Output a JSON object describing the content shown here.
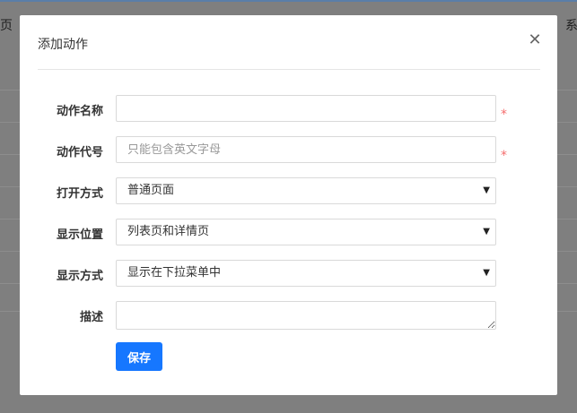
{
  "background": {
    "left_text": "页",
    "right_text": "系"
  },
  "modal": {
    "title": "添加动作",
    "close_icon": "close-icon"
  },
  "form": {
    "name": {
      "label": "动作名称",
      "value": "",
      "required_mark": "*"
    },
    "code": {
      "label": "动作代号",
      "value": "",
      "placeholder": "只能包含英文字母",
      "required_mark": "*"
    },
    "open_mode": {
      "label": "打开方式",
      "selected": "普通页面"
    },
    "position": {
      "label": "显示位置",
      "selected": "列表页和详情页"
    },
    "display_mode": {
      "label": "显示方式",
      "selected": "显示在下拉菜单中"
    },
    "description": {
      "label": "描述",
      "value": ""
    },
    "save_label": "保存"
  },
  "colors": {
    "primary": "#1677ff",
    "required": "#f56c6c",
    "overlay": "#7f7f7f"
  }
}
